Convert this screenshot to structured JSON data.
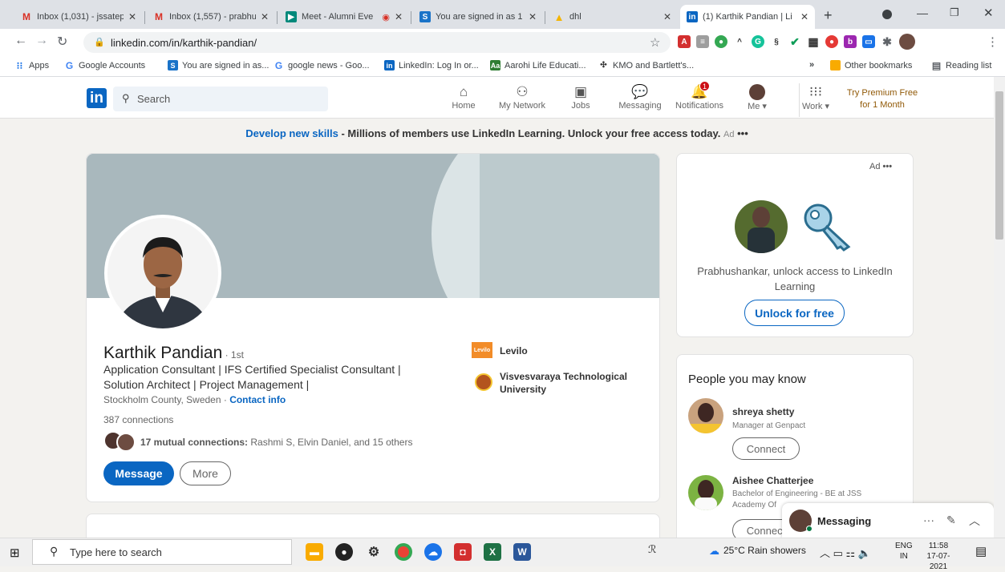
{
  "browser": {
    "tabs": [
      {
        "title": "Inbox (1,031) - jssatep",
        "icon": "gmail-icon"
      },
      {
        "title": "Inbox (1,557) - prabhu",
        "icon": "gmail-icon"
      },
      {
        "title": "Meet - Alumni Eve",
        "icon": "meet-icon"
      },
      {
        "title": "You are signed in as 1",
        "icon": "s-icon"
      },
      {
        "title": "dhl",
        "icon": "drive-icon"
      },
      {
        "title": "(1) Karthik Pandian | Li",
        "icon": "linkedin-icon"
      }
    ],
    "url": "linkedin.com/in/karthik-pandian/",
    "bookmarks": [
      "Apps",
      "Google Accounts",
      "You are signed in as...",
      "google news - Goo...",
      "LinkedIn: Log In or...",
      "Aarohi Life Educati...",
      "KMO and Bartlett's..."
    ],
    "bookmarks_right": [
      "»",
      "Other bookmarks",
      "Reading list"
    ]
  },
  "linkedin": {
    "search_placeholder": "Search",
    "nav": [
      "Home",
      "My Network",
      "Jobs",
      "Messaging",
      "Notifications",
      "Me",
      "Work"
    ],
    "notif_count": "1",
    "premium": "Try Premium Free for 1 Month",
    "banner_link": "Develop new skills",
    "banner_text": " - Millions of members use LinkedIn Learning. Unlock your free access today.",
    "banner_ad": "Ad",
    "profile": {
      "name": "Karthik Pandian",
      "degree": " · 1st",
      "headline": "Application Consultant | IFS Certified Specialist Consultant | Solution Architect | Project Management |",
      "location": "Stockholm County, Sweden · ",
      "contact": "Contact info",
      "connections": "387 connections",
      "mutual_bold": "17 mutual connections:",
      "mutual_rest": " Rashmi S, Elvin Daniel, and 15 others",
      "message": "Message",
      "more": "More",
      "company": "Levilo",
      "company_logo": "Levilo",
      "university": "Visvesvaraya Technological University"
    },
    "ad_card": {
      "ad": "Ad",
      "text": "Prabhushankar, unlock access to LinkedIn Learning",
      "button": "Unlock for free"
    },
    "pymk": {
      "title": "People you may know",
      "people": [
        {
          "name": "shreya shetty",
          "sub": "Manager at Genpact",
          "button": "Connect"
        },
        {
          "name": "Aishee Chatterjee",
          "sub": "Bachelor of Engineering - BE at JSS Academy Of",
          "button": "Connect"
        }
      ]
    },
    "messaging": "Messaging"
  },
  "taskbar": {
    "search": "Type here to search",
    "weather": "25°C  Rain showers",
    "lang1": "ENG",
    "lang2": "IN",
    "time": "11:58",
    "date": "17-07-2021"
  }
}
